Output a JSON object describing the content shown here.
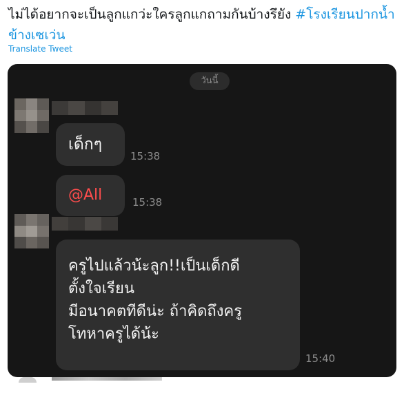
{
  "tweet": {
    "text": "ไม่ได้อยากจะเป็นลูกแกว่ะใครลูกแกถามกันบ้างรึยัง ",
    "hashtag": "#โรงเรียนปากน้ำข้างเซเว่น",
    "translate_label": "Translate Tweet"
  },
  "chat": {
    "date_label": "วันนี้",
    "messages": [
      {
        "text": "เด็กๆ",
        "time": "15:38"
      },
      {
        "text": "@All",
        "time": "15:38",
        "color": "#ff4d4d"
      },
      {
        "lines": [
          "ครูไปแล้วน้ะลูก!!เป็นเด็กดี",
          "ตั้งใจเรียน",
          "มีอนาคตทีดีน่ะ ถ้าคิดถึงครู",
          "โทหาครูได้น้ะ"
        ],
        "time": "15:40"
      }
    ]
  },
  "colors": {
    "hashtag": "#1b95e0",
    "chat_background": "#161616",
    "bubble": "#2f2f2f",
    "mention": "#ff4d4d"
  }
}
